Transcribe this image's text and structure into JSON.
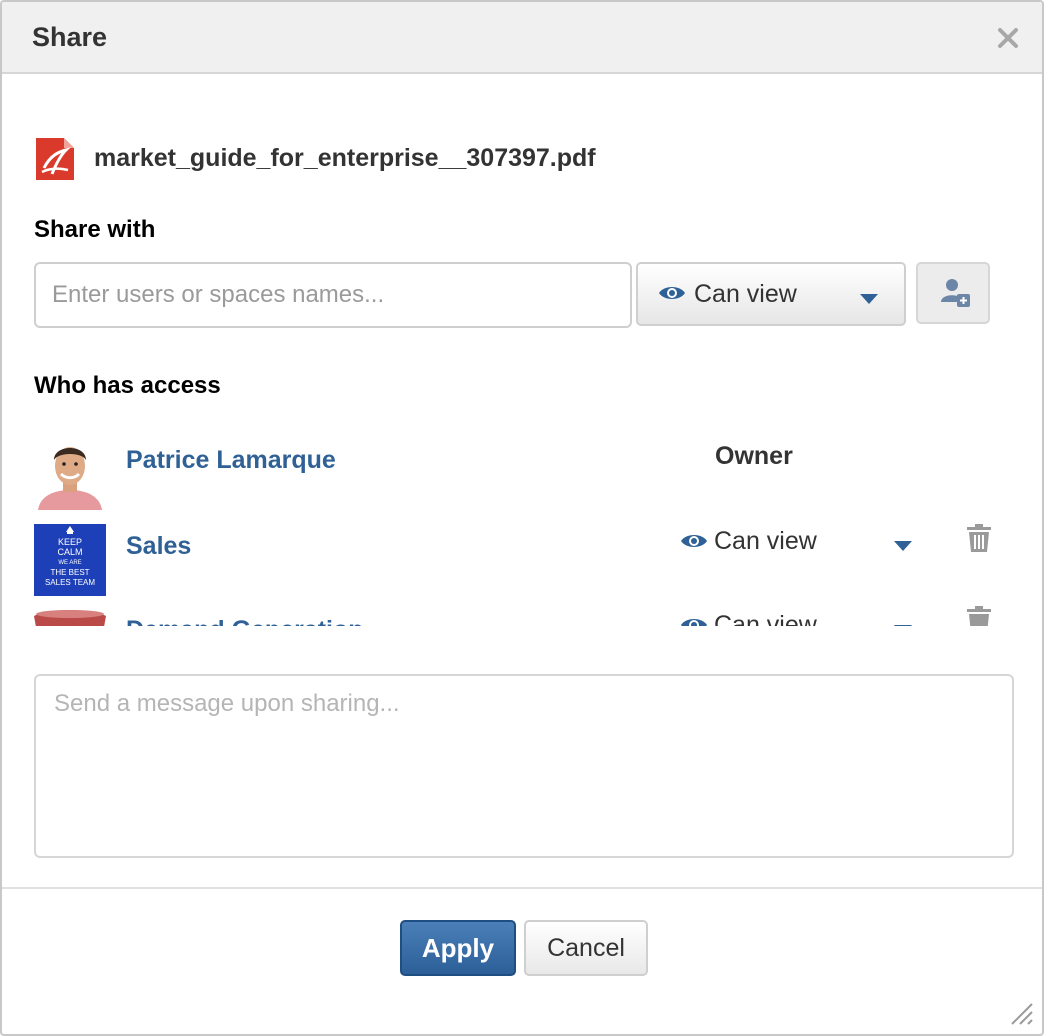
{
  "dialog": {
    "title": "Share",
    "close_icon": "close-icon"
  },
  "file": {
    "icon": "pdf-file-icon",
    "name": "market_guide_for_enterprise__307397.pdf",
    "icon_color": "#d93a2b"
  },
  "share_with": {
    "label": "Share with",
    "input_placeholder": "Enter users or spaces names...",
    "input_value": "",
    "permission": {
      "icon": "eye-icon",
      "label": "Can view",
      "caret_icon": "caret-down-icon"
    },
    "add_button_icon": "add-user-icon"
  },
  "access": {
    "label": "Who has access",
    "members": [
      {
        "name": "Patrice Lamarque",
        "avatar": "user-photo",
        "role": "Owner"
      },
      {
        "name": "Sales",
        "avatar": "keep-calm-poster",
        "avatar_text": [
          "KEEP",
          "CALM",
          "WE ARE",
          "THE BEST",
          "SALES TEAM"
        ],
        "permission": "Can view",
        "remove_icon": "trash-icon"
      },
      {
        "name": "Demand Generation",
        "avatar": "space-image",
        "permission": "Can view",
        "remove_icon": "trash-icon"
      }
    ]
  },
  "message": {
    "placeholder": "Send a message upon sharing...",
    "value": ""
  },
  "buttons": {
    "apply": "Apply",
    "cancel": "Cancel"
  },
  "colors": {
    "link": "#2f6196",
    "primary_button": "#2c5f97",
    "header_bg": "#f0f0f0"
  }
}
